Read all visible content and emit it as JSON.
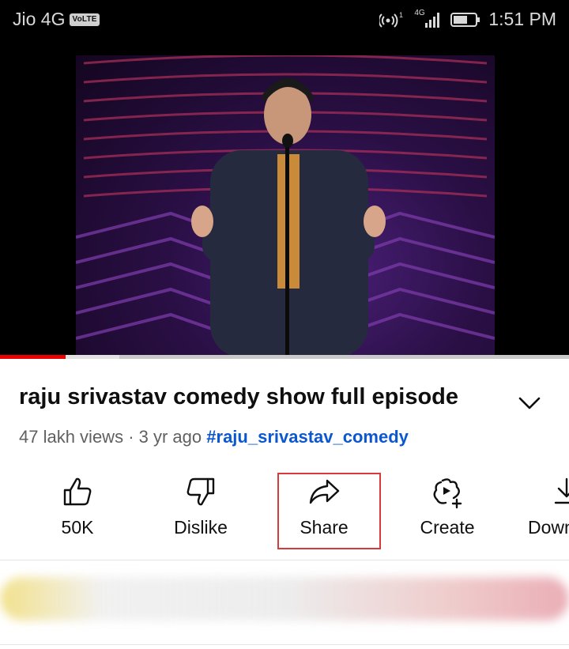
{
  "status_bar": {
    "carrier": "Jio 4G",
    "volte_badge": "VoLTE",
    "network_type": "4G",
    "time": "1:51 PM"
  },
  "video": {
    "progress_played": 0.115,
    "progress_buffered": 0.21,
    "title": "raju srivastav comedy show full episode",
    "views": "47 lakh views",
    "age": "3 yr ago",
    "separator": " · ",
    "hashtag": "#raju_srivastav_comedy"
  },
  "actions": {
    "like_count": "50K",
    "dislike_label": "Dislike",
    "share_label": "Share",
    "create_label": "Create",
    "download_label": "Down"
  },
  "colors": {
    "progress_red": "#e60000",
    "hashtag_blue": "#0b57d0",
    "highlight_red": "#d63a3a"
  }
}
